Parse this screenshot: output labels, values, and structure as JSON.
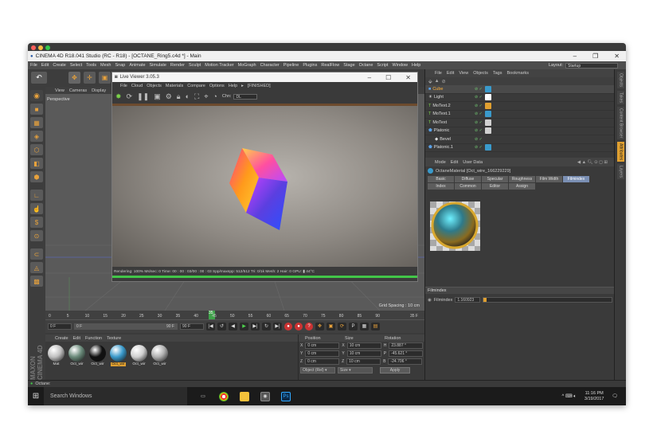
{
  "window": {
    "title": "CINEMA 4D R18.041 Studio (RC - R18) - [OCTANE_Ring5.c4d *] - Main",
    "controls": [
      "–",
      "❐",
      "✕"
    ]
  },
  "menubar": {
    "items": [
      "File",
      "Edit",
      "Create",
      "Select",
      "Tools",
      "Mesh",
      "Snap",
      "Animate",
      "Simulate",
      "Render",
      "Sculpt",
      "Motion Tracker",
      "MoGraph",
      "Character",
      "Pipeline",
      "Plugins",
      "RealFlow",
      "Stage",
      "Octane",
      "Script",
      "Window",
      "Help"
    ],
    "layout_label": "Layout:",
    "layout_value": "Startup"
  },
  "viewport": {
    "menu": [
      "View",
      "Cameras",
      "Display"
    ],
    "camera_label": "Perspective",
    "grid_spacing": "Grid Spacing : 10 cm"
  },
  "live_viewer": {
    "title": "Live Viewer 3.05.3",
    "controls": [
      "–",
      "☐",
      "✕"
    ],
    "menu": [
      "File",
      "Cloud",
      "Objects",
      "Materials",
      "Compare",
      "Options",
      "Help",
      "▸",
      "[FINISHED]"
    ],
    "chn_label": "Chn:",
    "chn_value": "DL",
    "status": "Rendering: 100%  Ms/sec: 0    Time: 00 : 00 : 03/00 : 00 : 03    Spp/maxspp: 512/512    Tri: 0/1k  Mesh: 2  Hair: 0       GPU: ▮     44°C",
    "progress": 1.0
  },
  "timeline": {
    "ticks": [
      "0",
      "5",
      "10",
      "15",
      "20",
      "25",
      "30",
      "35",
      "40",
      "45",
      "50",
      "55",
      "60",
      "65",
      "70",
      "75",
      "80",
      "85",
      "90"
    ],
    "current_frame_marker": "35",
    "end_frame_label": "35 F",
    "start_field": "0 F",
    "min_field": "0 F",
    "max_field": "90 F",
    "end_field": "90 F"
  },
  "materials": {
    "menu": [
      "Create",
      "Edit",
      "Function",
      "Texture"
    ],
    "items": [
      {
        "name": "Mat",
        "selected": false,
        "color": "#c0c0c0"
      },
      {
        "name": "Oct_wir",
        "selected": false,
        "color": "#6a8a7a"
      },
      {
        "name": "Oct_wir",
        "selected": false,
        "color": "#111111"
      },
      {
        "name": "Oct_wir",
        "selected": true,
        "color": "#3a9acb"
      },
      {
        "name": "Oct_wir",
        "selected": false,
        "color": "#d0d0d0"
      },
      {
        "name": "Oct_wir",
        "selected": false,
        "color": "#b0b0b0"
      }
    ]
  },
  "coordinates": {
    "headers": [
      "Position",
      "Size",
      "Rotation"
    ],
    "rows": [
      {
        "axis": "X",
        "pos": "0 cm",
        "size_axis": "X",
        "size": "10 cm",
        "rot_axis": "H",
        "rot": "23.887 °"
      },
      {
        "axis": "Y",
        "pos": "0 cm",
        "size_axis": "Y",
        "size": "10 cm",
        "rot_axis": "P",
        "rot": "-45.621 °"
      },
      {
        "axis": "Z",
        "pos": "0 cm",
        "size_axis": "Z",
        "size": "10 cm",
        "rot_axis": "B",
        "rot": "-24.706 °"
      }
    ],
    "mode_select": "Object (Rel) ▾",
    "size_select": "Size ▾",
    "apply_label": "Apply"
  },
  "status_bar": {
    "label": "Octane:"
  },
  "object_manager": {
    "menu": [
      "File",
      "Edit",
      "View",
      "Objects",
      "Tags",
      "Bookmarks"
    ],
    "objects": [
      {
        "name": "Cube",
        "selected": true,
        "icon": "cube-icon",
        "tag_color": "#3a9acb"
      },
      {
        "name": "Light",
        "selected": false,
        "icon": "light-icon",
        "tag_color": "#ffffff"
      },
      {
        "name": "MoText.2",
        "selected": false,
        "icon": "motext-icon",
        "tag_color": "#e0a030"
      },
      {
        "name": "MoText.1",
        "selected": false,
        "icon": "motext-icon",
        "tag_color": "#3a9acb"
      },
      {
        "name": "MoText",
        "selected": false,
        "icon": "motext-icon",
        "tag_color": "#d0d0d0"
      },
      {
        "name": "Platonic",
        "selected": false,
        "icon": "platonic-icon",
        "tag_color": "#d0d0d0"
      },
      {
        "name": "Bevel",
        "selected": false,
        "icon": "bevel-icon",
        "tag_color": ""
      },
      {
        "name": "Platonic.1",
        "selected": false,
        "icon": "platonic-icon",
        "tag_color": "#3a9acb"
      }
    ]
  },
  "attributes": {
    "menu": [
      "Mode",
      "Edit",
      "User Data"
    ],
    "material_title": "OctaneMaterial [Oct_wire_166229229]",
    "tabs": [
      {
        "label": "Basic",
        "active": false
      },
      {
        "label": "Diffuse",
        "active": false
      },
      {
        "label": "Specular",
        "active": false
      },
      {
        "label": "Roughness",
        "active": false
      },
      {
        "label": "Film Width",
        "active": false
      },
      {
        "label": "Filmindex",
        "active": true
      },
      {
        "label": "Index",
        "active": false
      },
      {
        "label": "Common",
        "active": false
      },
      {
        "label": "Editor",
        "active": false
      },
      {
        "label": "Assign",
        "active": false
      }
    ],
    "section_title": "Filmindex",
    "field_label": "Filmindex",
    "field_value": "1.160923",
    "field_level": 0.02
  },
  "right_tabs": [
    {
      "label": "Objects",
      "active": false
    },
    {
      "label": "Takes",
      "active": false
    },
    {
      "label": "Content Browser",
      "active": false
    },
    {
      "label": "Attributes",
      "active": true
    },
    {
      "label": "Layers",
      "active": false
    }
  ],
  "taskbar": {
    "search_placeholder": "Search Windows",
    "time": "11:16 PM",
    "date": "3/19/2017"
  },
  "colors": {
    "accent": "#e0a030",
    "render_progress": "#42c648",
    "panel": "#3a3a3a"
  }
}
